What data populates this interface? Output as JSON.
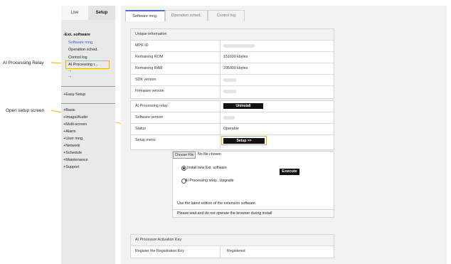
{
  "annotations": {
    "ai_processing_relay": "AI Processing Relay",
    "open_setup_screen": "Open setup screen"
  },
  "nav": {
    "tabs": [
      "Live",
      "Setup"
    ],
    "section_title": "-Ext. software",
    "sub_items": [
      "Software mng.",
      "Operation sched.",
      "Control log",
      "AI Processing r...",
      "...",
      "..."
    ],
    "easy_setup": "+Easy Setup",
    "items": [
      "+Basic",
      "+Image/Audio",
      "+Multi-screen",
      "+Alarm",
      "+User mng.",
      "+Network",
      "+Schedule",
      "+Maintenance",
      "+Support"
    ]
  },
  "tabs": [
    "Software mng.",
    "Operation sched.",
    "Control log"
  ],
  "unique": {
    "header": "Unique information",
    "rows": [
      {
        "label": "MPR ID",
        "value": ""
      },
      {
        "label": "Remaining ROM",
        "value": "151600 kbytes"
      },
      {
        "label": "Remaining RAM",
        "value": "295000 kbytes"
      },
      {
        "label": "SDK version",
        "value": ""
      },
      {
        "label": "Firmware version",
        "value": ""
      }
    ]
  },
  "relay": {
    "rows": [
      {
        "label": "AI Processing relay",
        "value": ""
      },
      {
        "label": "Software version",
        "value": ""
      },
      {
        "label": "Status",
        "value": "Operable"
      },
      {
        "label": "Setup menu",
        "value": ""
      }
    ],
    "uninstall_label": "Uninstall",
    "setup_label": "Setup >>"
  },
  "install": {
    "choose_file": "Choose File",
    "no_file": "No file chosen",
    "option_new": "Install new Ext. software",
    "option_upgrade": "AI Processing relay...Upgrade",
    "execute": "Execute",
    "note": "Use the latest edition of the extension software.",
    "wait": "Please wait and do not operate the browser during install"
  },
  "activation": {
    "header": "AI Processor Activation Key",
    "label": "Register the Registration Key",
    "value": "Registered"
  },
  "colors": {
    "highlight": "#f0b400",
    "accent": "#3a5fcf"
  }
}
